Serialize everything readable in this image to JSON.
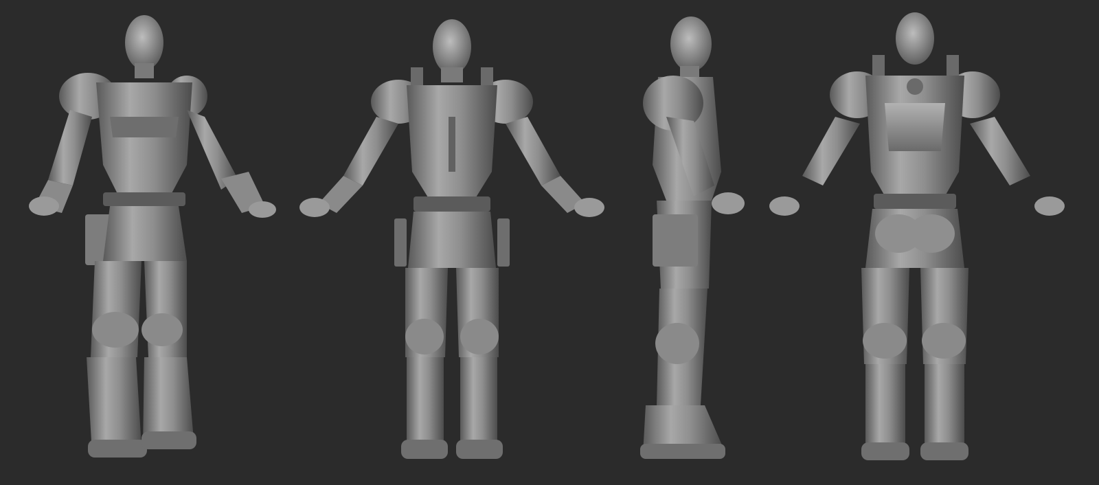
{
  "scene": {
    "background": "#2b2b2b",
    "material_light": "#a9a9a9",
    "material_mid": "#7c7c7c",
    "material_dark": "#4a4a4a",
    "views": [
      {
        "id": "three-quarter",
        "icon": "armored-figure-three-quarter"
      },
      {
        "id": "front",
        "icon": "armored-figure-front"
      },
      {
        "id": "side",
        "icon": "armored-figure-side"
      },
      {
        "id": "back",
        "icon": "armored-figure-back"
      }
    ]
  }
}
